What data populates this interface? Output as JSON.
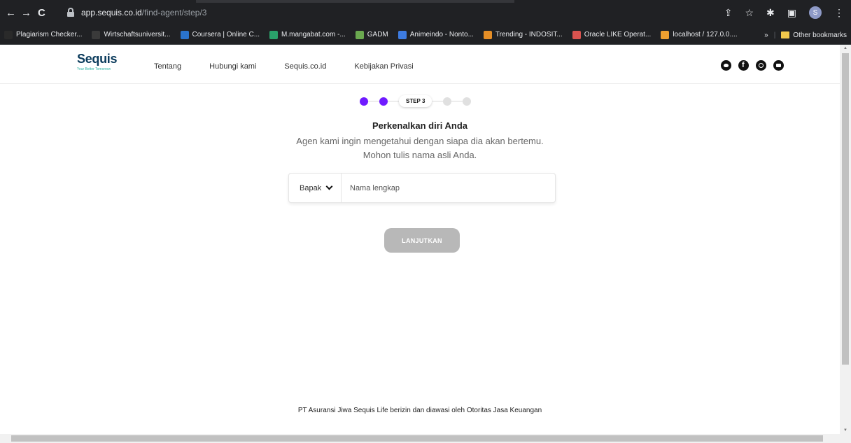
{
  "browser": {
    "url_domain": "app.sequis.co.id",
    "url_path": "/find-agent/step/3",
    "profile_initial": "S",
    "bookmarks": [
      {
        "label": "Plagiarism Checker...",
        "icon": "sst-icon",
        "color": "#2a2a2a"
      },
      {
        "label": "Wirtschaftsuniversit...",
        "icon": "w-icon",
        "color": "#3a3a3a"
      },
      {
        "label": "Coursera | Online C...",
        "icon": "coursera-icon",
        "color": "#2a73cc"
      },
      {
        "label": "M.mangabat.com -...",
        "icon": "mangabat-icon",
        "color": "#2aa16a"
      },
      {
        "label": "GADM",
        "icon": "gadm-icon",
        "color": "#6aa84f"
      },
      {
        "label": "Animeindo - Nonto...",
        "icon": "animeindo-icon",
        "color": "#3d7be0"
      },
      {
        "label": "Trending - INDOSIT...",
        "icon": "indosit-icon",
        "color": "#e58e26"
      },
      {
        "label": "Oracle LIKE Operat...",
        "icon": "oracle-icon",
        "color": "#d9534f"
      },
      {
        "label": "localhost / 127.0.0....",
        "icon": "phpmyadmin-icon",
        "color": "#f0a030"
      }
    ],
    "more_label": "»",
    "other_bookmarks": "Other bookmarks"
  },
  "site": {
    "logo": "Sequis",
    "tagline": "Your Better Tomorrow",
    "nav": [
      "Tentang",
      "Hubungi kami",
      "Sequis.co.id",
      "Kebijakan Privasi"
    ],
    "social_icons": [
      "twitter-icon",
      "facebook-icon",
      "instagram-icon",
      "youtube-icon"
    ]
  },
  "stepper": {
    "current_label": "STEP 3",
    "completed_steps": 2,
    "total_steps": 5
  },
  "form": {
    "title": "Perkenalkan diri Anda",
    "subtitle_line1": "Agen kami ingin mengetahui dengan siapa dia akan bertemu.",
    "subtitle_line2": "Mohon tulis nama asli Anda.",
    "salutation_value": "Bapak",
    "name_placeholder": "Nama lengkap",
    "submit_label": "LANJUTKAN"
  },
  "footer": {
    "text": "PT Asuransi Jiwa Sequis Life berizin dan diawasi oleh Otoritas Jasa Keuangan"
  },
  "colors": {
    "accent": "#6f1bff",
    "button_disabled": "#b8b8b8"
  }
}
